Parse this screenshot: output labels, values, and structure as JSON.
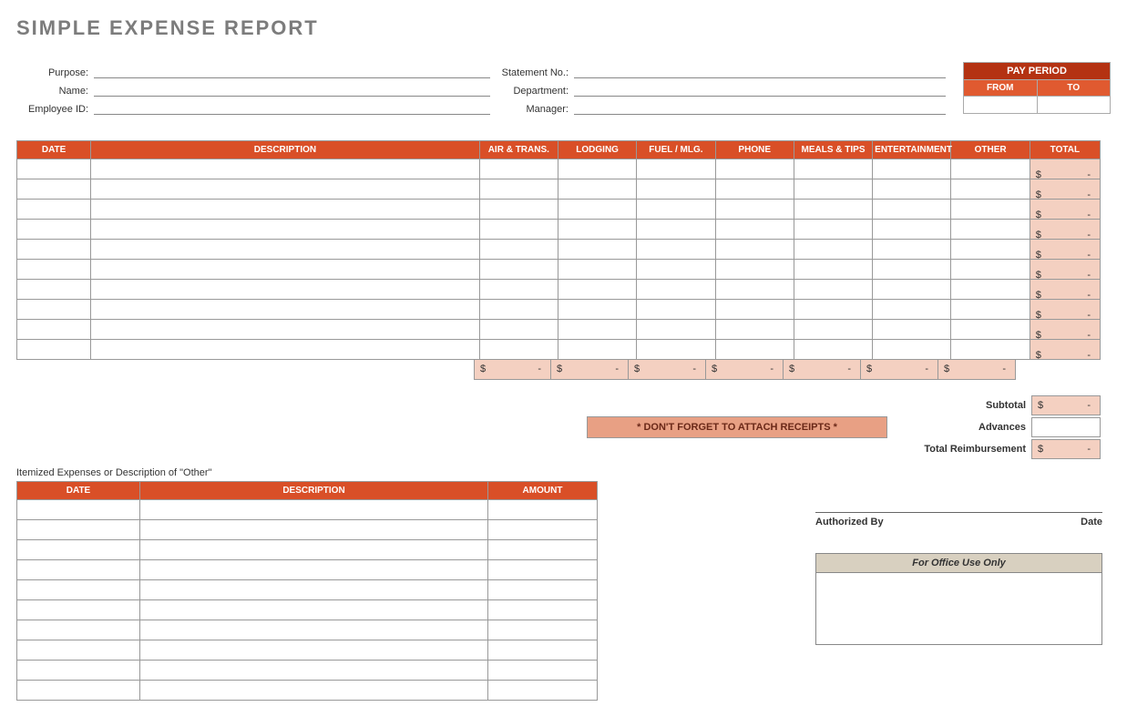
{
  "title": "SIMPLE EXPENSE REPORT",
  "info_left_labels": [
    "Purpose:",
    "Name:",
    "Employee ID:"
  ],
  "info_right_labels": [
    "Statement No.:",
    "Department:",
    "Manager:"
  ],
  "pay_period": {
    "header": "PAY PERIOD",
    "from": "FROM",
    "to": "TO"
  },
  "expense_headers": [
    "DATE",
    "DESCRIPTION",
    "AIR & TRANS.",
    "LODGING",
    "FUEL / MLG.",
    "PHONE",
    "MEALS & TIPS",
    "ENTERTAINMENT",
    "OTHER",
    "TOTAL"
  ],
  "expense_row_count": 10,
  "category_count": 7,
  "summary": {
    "subtotal": "Subtotal",
    "advances": "Advances",
    "total": "Total Reimbursement",
    "receipts_note": "* DON'T FORGET TO ATTACH RECEIPTS *"
  },
  "itemized_caption": "Itemized Expenses or Description of \"Other\"",
  "itemized_headers": [
    "DATE",
    "DESCRIPTION",
    "AMOUNT"
  ],
  "itemized_row_count": 10,
  "auth": {
    "by": "Authorized By",
    "date": "Date"
  },
  "office": {
    "header": "For Office Use Only"
  }
}
